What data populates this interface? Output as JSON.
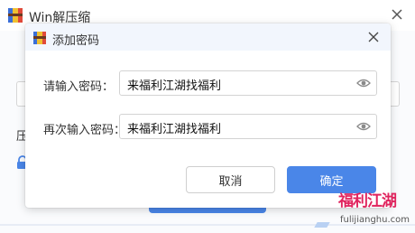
{
  "parent_window": {
    "title": "Win解压缩",
    "label_partial": "压"
  },
  "dialog": {
    "title": "添加密码",
    "password_label": "请输入密码：",
    "password_value": "来福利江湖找福利",
    "confirm_label": "再次输入密码：",
    "confirm_value": "来福利江湖找福利",
    "cancel_label": "取消",
    "ok_label": "确定"
  },
  "watermark": {
    "main": "福利江湖",
    "url": "fulijianghu.com"
  },
  "colors": {
    "accent": "#4a86e8",
    "title_bg": "#f2f6fd",
    "watermark": "#e0245e"
  },
  "icons": [
    "app-icon",
    "close-icon",
    "lock-icon",
    "eye-icon"
  ]
}
